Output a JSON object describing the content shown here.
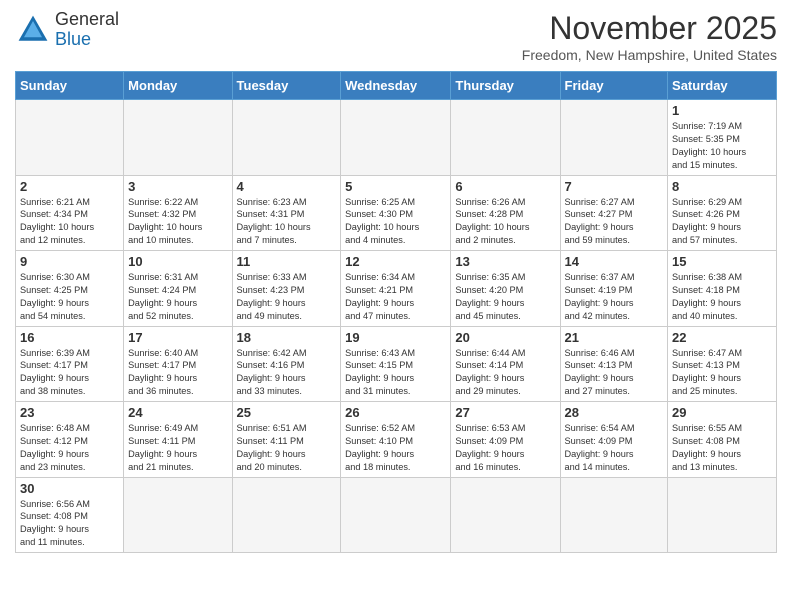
{
  "logo": {
    "line1": "General",
    "line2": "Blue"
  },
  "title": "November 2025",
  "subtitle": "Freedom, New Hampshire, United States",
  "days_of_week": [
    "Sunday",
    "Monday",
    "Tuesday",
    "Wednesday",
    "Thursday",
    "Friday",
    "Saturday"
  ],
  "weeks": [
    [
      {
        "day": "",
        "info": ""
      },
      {
        "day": "",
        "info": ""
      },
      {
        "day": "",
        "info": ""
      },
      {
        "day": "",
        "info": ""
      },
      {
        "day": "",
        "info": ""
      },
      {
        "day": "",
        "info": ""
      },
      {
        "day": "1",
        "info": "Sunrise: 7:19 AM\nSunset: 5:35 PM\nDaylight: 10 hours\nand 15 minutes."
      }
    ],
    [
      {
        "day": "2",
        "info": "Sunrise: 6:21 AM\nSunset: 4:34 PM\nDaylight: 10 hours\nand 12 minutes."
      },
      {
        "day": "3",
        "info": "Sunrise: 6:22 AM\nSunset: 4:32 PM\nDaylight: 10 hours\nand 10 minutes."
      },
      {
        "day": "4",
        "info": "Sunrise: 6:23 AM\nSunset: 4:31 PM\nDaylight: 10 hours\nand 7 minutes."
      },
      {
        "day": "5",
        "info": "Sunrise: 6:25 AM\nSunset: 4:30 PM\nDaylight: 10 hours\nand 4 minutes."
      },
      {
        "day": "6",
        "info": "Sunrise: 6:26 AM\nSunset: 4:28 PM\nDaylight: 10 hours\nand 2 minutes."
      },
      {
        "day": "7",
        "info": "Sunrise: 6:27 AM\nSunset: 4:27 PM\nDaylight: 9 hours\nand 59 minutes."
      },
      {
        "day": "8",
        "info": "Sunrise: 6:29 AM\nSunset: 4:26 PM\nDaylight: 9 hours\nand 57 minutes."
      }
    ],
    [
      {
        "day": "9",
        "info": "Sunrise: 6:30 AM\nSunset: 4:25 PM\nDaylight: 9 hours\nand 54 minutes."
      },
      {
        "day": "10",
        "info": "Sunrise: 6:31 AM\nSunset: 4:24 PM\nDaylight: 9 hours\nand 52 minutes."
      },
      {
        "day": "11",
        "info": "Sunrise: 6:33 AM\nSunset: 4:23 PM\nDaylight: 9 hours\nand 49 minutes."
      },
      {
        "day": "12",
        "info": "Sunrise: 6:34 AM\nSunset: 4:21 PM\nDaylight: 9 hours\nand 47 minutes."
      },
      {
        "day": "13",
        "info": "Sunrise: 6:35 AM\nSunset: 4:20 PM\nDaylight: 9 hours\nand 45 minutes."
      },
      {
        "day": "14",
        "info": "Sunrise: 6:37 AM\nSunset: 4:19 PM\nDaylight: 9 hours\nand 42 minutes."
      },
      {
        "day": "15",
        "info": "Sunrise: 6:38 AM\nSunset: 4:18 PM\nDaylight: 9 hours\nand 40 minutes."
      }
    ],
    [
      {
        "day": "16",
        "info": "Sunrise: 6:39 AM\nSunset: 4:17 PM\nDaylight: 9 hours\nand 38 minutes."
      },
      {
        "day": "17",
        "info": "Sunrise: 6:40 AM\nSunset: 4:17 PM\nDaylight: 9 hours\nand 36 minutes."
      },
      {
        "day": "18",
        "info": "Sunrise: 6:42 AM\nSunset: 4:16 PM\nDaylight: 9 hours\nand 33 minutes."
      },
      {
        "day": "19",
        "info": "Sunrise: 6:43 AM\nSunset: 4:15 PM\nDaylight: 9 hours\nand 31 minutes."
      },
      {
        "day": "20",
        "info": "Sunrise: 6:44 AM\nSunset: 4:14 PM\nDaylight: 9 hours\nand 29 minutes."
      },
      {
        "day": "21",
        "info": "Sunrise: 6:46 AM\nSunset: 4:13 PM\nDaylight: 9 hours\nand 27 minutes."
      },
      {
        "day": "22",
        "info": "Sunrise: 6:47 AM\nSunset: 4:13 PM\nDaylight: 9 hours\nand 25 minutes."
      }
    ],
    [
      {
        "day": "23",
        "info": "Sunrise: 6:48 AM\nSunset: 4:12 PM\nDaylight: 9 hours\nand 23 minutes."
      },
      {
        "day": "24",
        "info": "Sunrise: 6:49 AM\nSunset: 4:11 PM\nDaylight: 9 hours\nand 21 minutes."
      },
      {
        "day": "25",
        "info": "Sunrise: 6:51 AM\nSunset: 4:11 PM\nDaylight: 9 hours\nand 20 minutes."
      },
      {
        "day": "26",
        "info": "Sunrise: 6:52 AM\nSunset: 4:10 PM\nDaylight: 9 hours\nand 18 minutes."
      },
      {
        "day": "27",
        "info": "Sunrise: 6:53 AM\nSunset: 4:09 PM\nDaylight: 9 hours\nand 16 minutes."
      },
      {
        "day": "28",
        "info": "Sunrise: 6:54 AM\nSunset: 4:09 PM\nDaylight: 9 hours\nand 14 minutes."
      },
      {
        "day": "29",
        "info": "Sunrise: 6:55 AM\nSunset: 4:08 PM\nDaylight: 9 hours\nand 13 minutes."
      }
    ],
    [
      {
        "day": "30",
        "info": "Sunrise: 6:56 AM\nSunset: 4:08 PM\nDaylight: 9 hours\nand 11 minutes."
      },
      {
        "day": "",
        "info": ""
      },
      {
        "day": "",
        "info": ""
      },
      {
        "day": "",
        "info": ""
      },
      {
        "day": "",
        "info": ""
      },
      {
        "day": "",
        "info": ""
      },
      {
        "day": "",
        "info": ""
      }
    ]
  ]
}
